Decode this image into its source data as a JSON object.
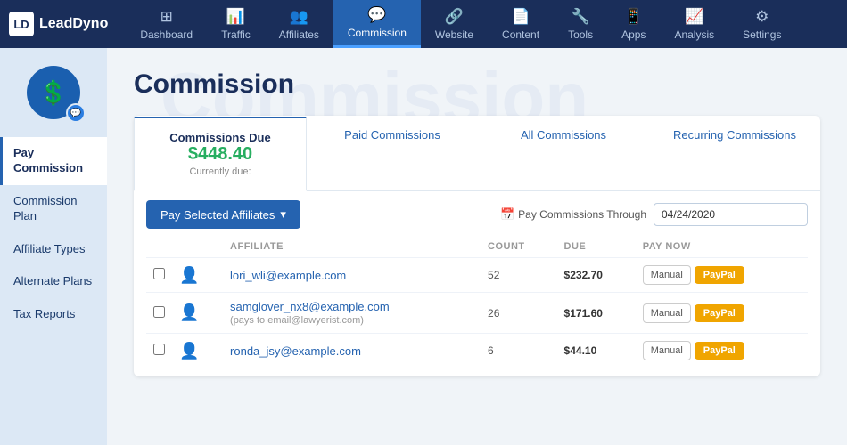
{
  "logo": {
    "icon_text": "LD",
    "brand_name": "LeadDyno"
  },
  "navbar": {
    "items": [
      {
        "id": "dashboard",
        "label": "Dashboard",
        "icon": "⊞"
      },
      {
        "id": "traffic",
        "label": "Traffic",
        "icon": "📊"
      },
      {
        "id": "affiliates",
        "label": "Affiliates",
        "icon": "👥"
      },
      {
        "id": "commission",
        "label": "Commission",
        "icon": "💬"
      },
      {
        "id": "website",
        "label": "Website",
        "icon": "🔗"
      },
      {
        "id": "content",
        "label": "Content",
        "icon": "📄"
      },
      {
        "id": "tools",
        "label": "Tools",
        "icon": "🔧"
      },
      {
        "id": "apps",
        "label": "Apps",
        "icon": "📱"
      },
      {
        "id": "analysis",
        "label": "Analysis",
        "icon": "📈"
      },
      {
        "id": "settings",
        "label": "Settings",
        "icon": "⚙"
      }
    ]
  },
  "sidebar": {
    "items": [
      {
        "id": "pay-commission",
        "label": "Pay Commission",
        "active": true
      },
      {
        "id": "commission-plan",
        "label": "Commission Plan",
        "active": false
      },
      {
        "id": "affiliate-types",
        "label": "Affiliate Types",
        "active": false
      },
      {
        "id": "alternate-plans",
        "label": "Alternate Plans",
        "active": false
      },
      {
        "id": "tax-reports",
        "label": "Tax Reports",
        "active": false
      }
    ]
  },
  "page": {
    "title": "Commission",
    "bg_title": "Commission"
  },
  "tabs": [
    {
      "id": "commissions-due",
      "label": "Commissions Due",
      "amount": "$448.40",
      "subtitle": "Currently due:",
      "active": true
    },
    {
      "id": "paid-commissions",
      "label": "Paid Commissions",
      "active": false
    },
    {
      "id": "all-commissions",
      "label": "All Commissions",
      "active": false
    },
    {
      "id": "recurring-commissions",
      "label": "Recurring Commissions",
      "active": false
    }
  ],
  "toolbar": {
    "pay_button_label": "Pay Selected Affiliates",
    "date_filter_label": "Pay Commissions Through",
    "date_value": "04/24/2020"
  },
  "table": {
    "columns": [
      {
        "id": "check",
        "label": ""
      },
      {
        "id": "avatar",
        "label": ""
      },
      {
        "id": "affiliate",
        "label": "Affiliate"
      },
      {
        "id": "count",
        "label": "Count"
      },
      {
        "id": "due",
        "label": "Due"
      },
      {
        "id": "pay_now",
        "label": "Pay Now"
      }
    ],
    "rows": [
      {
        "id": "row1",
        "affiliate_email": "lori_wli@example.com",
        "sub_text": "",
        "count": "52",
        "due": "$232.70",
        "manual_label": "Manual",
        "paypal_label": "PayPal"
      },
      {
        "id": "row2",
        "affiliate_email": "samglover_nx8@example.com",
        "sub_text": "(pays to email@lawyerist.com)",
        "count": "26",
        "due": "$171.60",
        "manual_label": "Manual",
        "paypal_label": "PayPal"
      },
      {
        "id": "row3",
        "affiliate_email": "ronda_jsy@example.com",
        "sub_text": "",
        "count": "6",
        "due": "$44.10",
        "manual_label": "Manual",
        "paypal_label": "PayPal"
      }
    ]
  }
}
